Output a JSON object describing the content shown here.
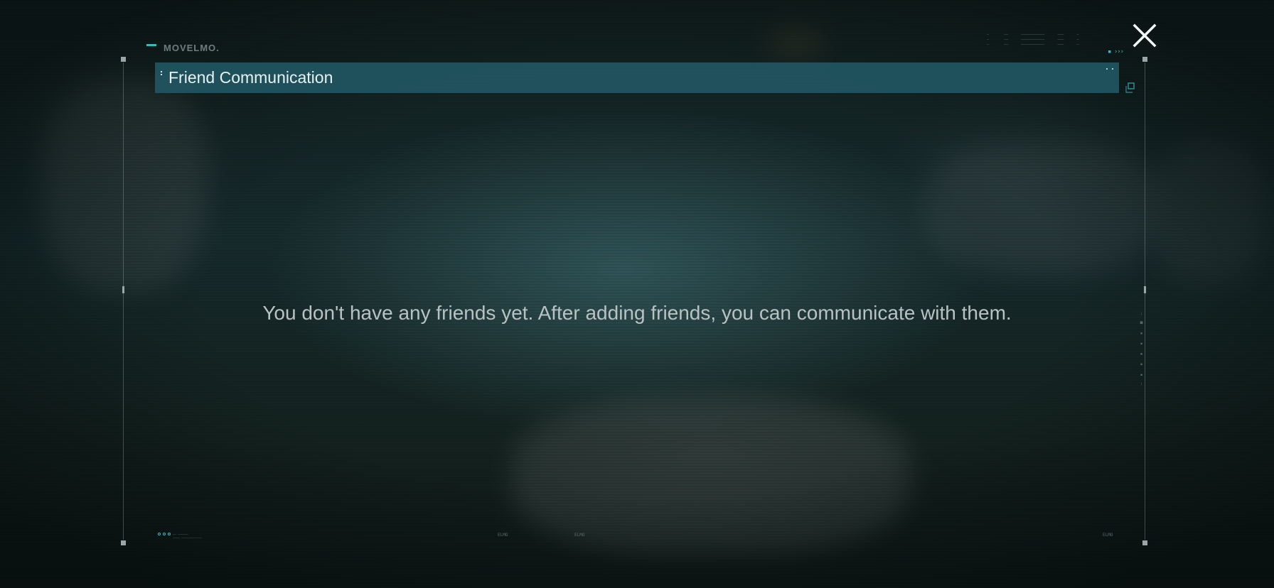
{
  "brand": {
    "name": "MOVELMO."
  },
  "panel": {
    "title": "Friend Communication",
    "empty_message": "You don't have any friends yet. After adding friends, you can communicate with them."
  },
  "controls": {
    "close_icon": "close-icon",
    "expand_icon": "expand-icon"
  },
  "footer": {
    "codes": [
      "ELMO",
      "ELMO",
      "ELMO"
    ]
  },
  "colors": {
    "accent": "#3bb8bf",
    "title_bar": "#215460",
    "message_text": "#b9c2c3",
    "title_text": "#e8f1f1"
  }
}
